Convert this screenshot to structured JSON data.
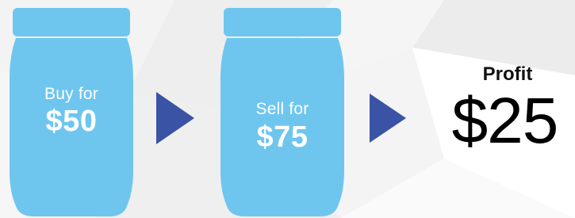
{
  "colors": {
    "jar_fill": "#6ec6ef",
    "arrow_fill": "#3a53a4",
    "text_on_jar": "#ffffff",
    "profit_text": "#000000"
  },
  "step_buy": {
    "label": "Buy for",
    "price": "$50"
  },
  "step_sell": {
    "label": "Sell for",
    "price": "$75"
  },
  "profit": {
    "label": "Profit",
    "value": "$25"
  },
  "icons": [
    "jar-icon",
    "arrow-right-icon",
    "jar-icon",
    "arrow-right-icon"
  ]
}
